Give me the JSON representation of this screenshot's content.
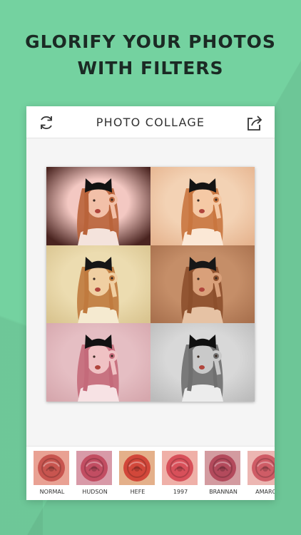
{
  "headline": {
    "line1": "GLORIFY YOUR PHOTOS",
    "line2": "WITH FILTERS"
  },
  "topbar": {
    "title": "PHOTO COLLAGE",
    "left_icon": "refresh-icon",
    "right_icon": "share-icon"
  },
  "collage": {
    "cells": [
      {
        "filter": "vignette-dark",
        "bg": "#f3c8c2",
        "edge": "#4a2420"
      },
      {
        "filter": "warm",
        "bg": "#f3d2b4",
        "edge": "#e6b48f"
      },
      {
        "filter": "yellow",
        "bg": "#ecdcb0",
        "edge": "#d9c48f"
      },
      {
        "filter": "brown",
        "bg": "#c58e68",
        "edge": "#a8704d"
      },
      {
        "filter": "pink",
        "bg": "#e5bec3",
        "edge": "#d6a7ad"
      },
      {
        "filter": "mono",
        "bg": "#d8d8d8",
        "edge": "#bbbbbb"
      }
    ]
  },
  "filters": [
    {
      "label": "NORMAL",
      "tint": "#c8554f",
      "bg": "#e9a193"
    },
    {
      "label": "HUDSON",
      "tint": "#c24d62",
      "bg": "#d89aa8"
    },
    {
      "label": "HEFE",
      "tint": "#d2473a",
      "bg": "#e4b08a"
    },
    {
      "label": "1997",
      "tint": "#d8505a",
      "bg": "#efb0a8"
    },
    {
      "label": "BRANNAN",
      "tint": "#b34a5c",
      "bg": "#d39ba0"
    },
    {
      "label": "AMARO",
      "tint": "#cf5c66",
      "bg": "#ecb6b2"
    }
  ]
}
